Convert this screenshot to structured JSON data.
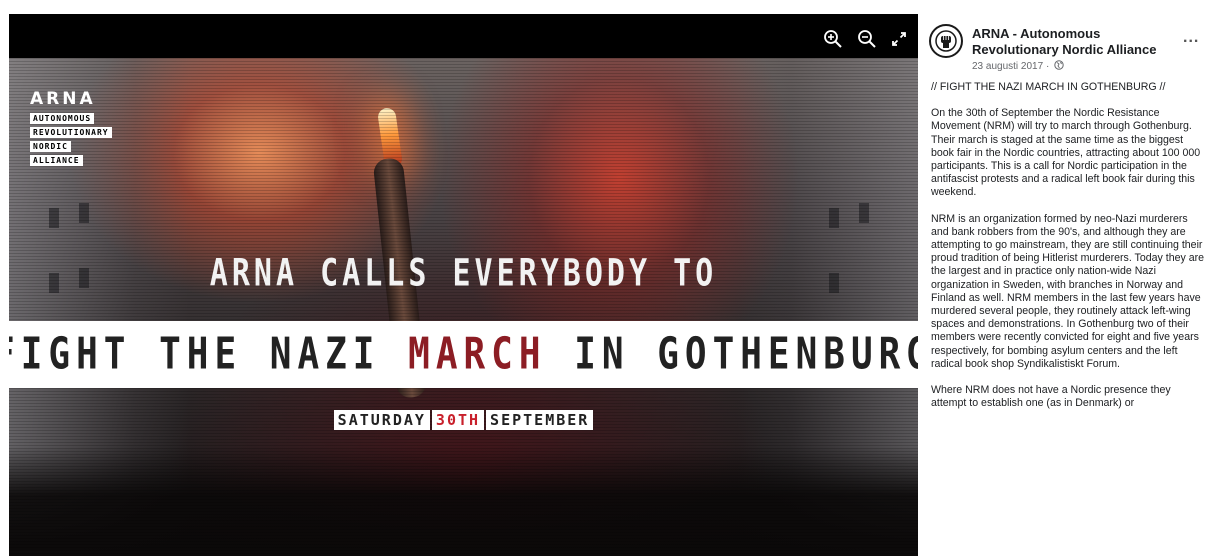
{
  "poster": {
    "logo_title": "ARNA",
    "logo_words": [
      "AUTONOMOUS",
      "REVOLUTIONARY",
      "NORDIC",
      "ALLIANCE"
    ],
    "headline_1": "ARNA CALLS EVERYBODY TO",
    "banner_part_1": "FIGHT THE NAZI ",
    "banner_part_2": "MARCH",
    "banner_part_3": " IN GOTHENBURG",
    "date_part_1": "SATURDAY",
    "date_part_2": "30TH",
    "date_part_3": "SEPTEMBER"
  },
  "viewer_controls": {
    "icons": [
      "zoom-in-icon",
      "zoom-out-icon",
      "expand-icon"
    ]
  },
  "post": {
    "page_name": "ARNA - Autonomous Revolutionary Nordic Alliance",
    "date": "23 augusti 2017 ·",
    "more_label": "...",
    "paragraphs": [
      "// FIGHT THE NAZI MARCH IN GOTHENBURG //",
      "On the 30th of September the Nordic Resistance Movement (NRM) will try to march through Gothenburg. Their march is staged at the same time as the biggest book fair in the Nordic countries, attracting about 100 000 participants. This is a call for Nordic participation in the antifascist protests and a radical left book fair during this weekend.",
      "NRM is an organization formed by neo-Nazi murderers and bank robbers from the 90's, and although they are attempting to go mainstream, they are still continuing their proud tradition of being Hitlerist murderers. Today they are the largest and in practice only nation-wide Nazi organization in Sweden, with branches in Norway and Finland as well. NRM members in the last few years have murdered several people, they routinely attack left-wing spaces and demonstrations. In Gothenburg two of their members were recently convicted for eight and five years respectively, for bombing asylum centers and the left radical book shop Syndikalistiskt Forum.",
      "Where NRM does not have a Nordic presence they attempt to establish one (as in Denmark) or"
    ]
  },
  "colors": {
    "banner_accent": "#8c1d24",
    "date_accent": "#c8202b",
    "viewer_bg": "#000000",
    "secondary_text": "#65676b"
  }
}
